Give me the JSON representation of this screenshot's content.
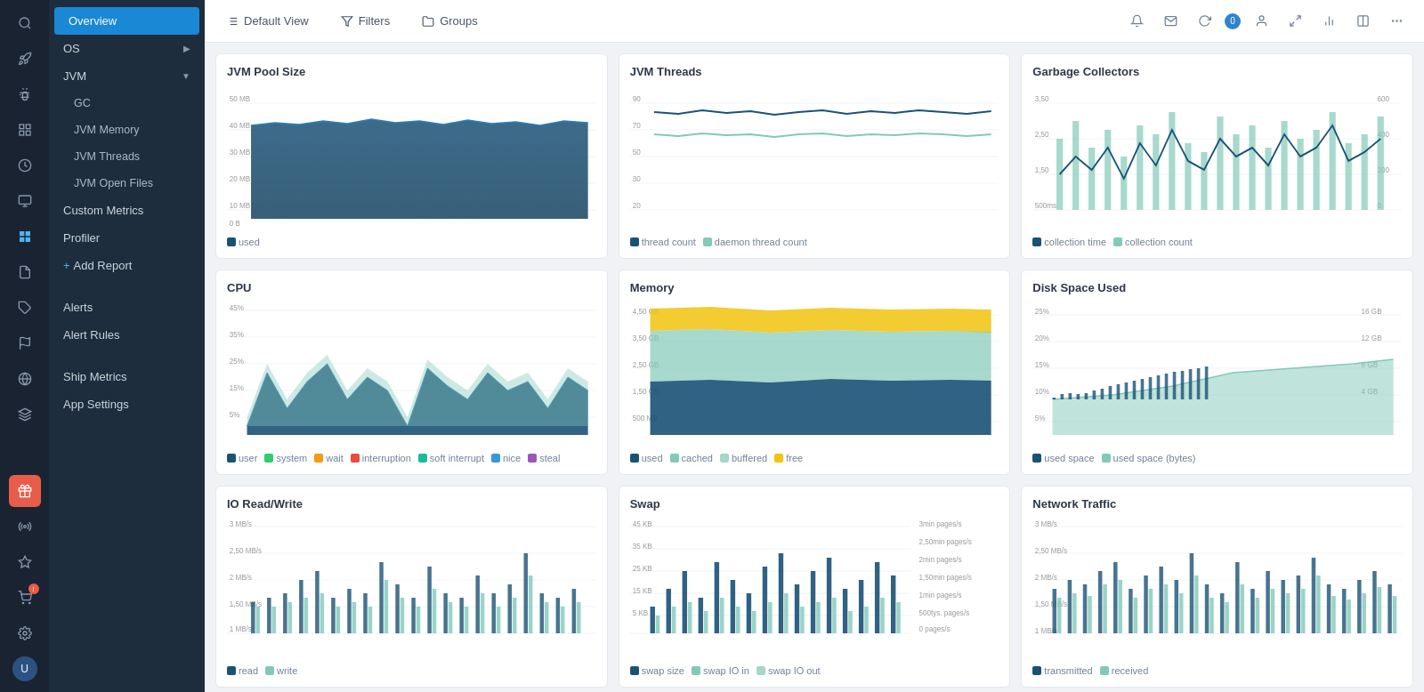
{
  "iconRail": {
    "icons": [
      {
        "name": "search-icon",
        "symbol": "🔍"
      },
      {
        "name": "rocket-icon",
        "symbol": "🚀"
      },
      {
        "name": "bug-icon",
        "symbol": "🐛"
      },
      {
        "name": "grid-icon",
        "symbol": "⊞"
      },
      {
        "name": "clock-icon",
        "symbol": "⏱"
      },
      {
        "name": "monitor-icon",
        "symbol": "🖥"
      },
      {
        "name": "dashboard-active-icon",
        "symbol": "▦"
      },
      {
        "name": "document-icon",
        "symbol": "📄"
      },
      {
        "name": "puzzle-icon",
        "symbol": "🧩"
      },
      {
        "name": "flag-icon",
        "symbol": "🚩"
      },
      {
        "name": "globe-icon",
        "symbol": "🌐"
      },
      {
        "name": "layers-icon",
        "symbol": "⚙"
      }
    ],
    "bottomIcons": [
      {
        "name": "gift-icon",
        "symbol": "🎁"
      },
      {
        "name": "broadcast-icon",
        "symbol": "📡"
      },
      {
        "name": "star-icon",
        "symbol": "⭐"
      },
      {
        "name": "cart-icon",
        "symbol": "🛒"
      },
      {
        "name": "settings-icon",
        "symbol": "⚙"
      },
      {
        "name": "user-icon",
        "symbol": "👤"
      }
    ]
  },
  "sidebar": {
    "items": [
      {
        "label": "Overview",
        "active": true,
        "type": "main"
      },
      {
        "label": "OS",
        "type": "main",
        "hasArrow": true
      },
      {
        "label": "JVM",
        "type": "main",
        "hasChevron": true,
        "expanded": true
      },
      {
        "label": "GC",
        "type": "sub"
      },
      {
        "label": "JVM Memory",
        "type": "sub"
      },
      {
        "label": "JVM Threads",
        "type": "sub"
      },
      {
        "label": "JVM Open Files",
        "type": "sub"
      },
      {
        "label": "Custom Metrics",
        "type": "main"
      },
      {
        "label": "Profiler",
        "type": "main"
      },
      {
        "label": "Add Report",
        "type": "action"
      },
      {
        "label": "Alerts",
        "type": "main"
      },
      {
        "label": "Alert Rules",
        "type": "main"
      },
      {
        "label": "Ship Metrics",
        "type": "main"
      },
      {
        "label": "App Settings",
        "type": "main"
      }
    ]
  },
  "topbar": {
    "defaultView": "Default View",
    "filters": "Filters",
    "groups": "Groups",
    "badgeCount": "0"
  },
  "charts": [
    {
      "id": "jvm-pool-size",
      "title": "JVM Pool Size",
      "type": "area",
      "legend": [
        {
          "label": "used",
          "color": "#1a5276"
        }
      ]
    },
    {
      "id": "jvm-threads",
      "title": "JVM Threads",
      "type": "line",
      "legend": [
        {
          "label": "thread count",
          "color": "#1a5276"
        },
        {
          "label": "daemon thread count",
          "color": "#82c9b8"
        }
      ]
    },
    {
      "id": "garbage-collectors",
      "title": "Garbage Collectors",
      "type": "bar-line",
      "legend": [
        {
          "label": "collection time",
          "color": "#1a5276"
        },
        {
          "label": "collection count",
          "color": "#82c9b8"
        }
      ]
    },
    {
      "id": "cpu",
      "title": "CPU",
      "type": "stacked-area",
      "legend": [
        {
          "label": "user",
          "color": "#1a5276"
        },
        {
          "label": "system",
          "color": "#2ecc71"
        },
        {
          "label": "wait",
          "color": "#f39c12"
        },
        {
          "label": "interruption",
          "color": "#e74c3c"
        },
        {
          "label": "soft interrupt",
          "color": "#1abc9c"
        },
        {
          "label": "nice",
          "color": "#3498db"
        },
        {
          "label": "steal",
          "color": "#9b59b6"
        }
      ]
    },
    {
      "id": "memory",
      "title": "Memory",
      "type": "stacked-area",
      "legend": [
        {
          "label": "used",
          "color": "#1a5276"
        },
        {
          "label": "cached",
          "color": "#82c9b8"
        },
        {
          "label": "buffered",
          "color": "#a8d5c8"
        },
        {
          "label": "free",
          "color": "#f1c40f"
        }
      ]
    },
    {
      "id": "disk-space",
      "title": "Disk Space Used",
      "type": "area-bar",
      "legend": [
        {
          "label": "used space",
          "color": "#1a5276"
        },
        {
          "label": "used space (bytes)",
          "color": "#82c9b8"
        }
      ]
    },
    {
      "id": "io-readwrite",
      "title": "IO Read/Write",
      "type": "bar",
      "legend": [
        {
          "label": "read",
          "color": "#1a5276"
        },
        {
          "label": "write",
          "color": "#82c9b8"
        }
      ]
    },
    {
      "id": "swap",
      "title": "Swap",
      "type": "bar",
      "legend": [
        {
          "label": "swap size",
          "color": "#1a5276"
        },
        {
          "label": "swap IO in",
          "color": "#82c9b8"
        },
        {
          "label": "swap IO out",
          "color": "#a8d5c8"
        }
      ]
    },
    {
      "id": "network-traffic",
      "title": "Network Traffic",
      "type": "bar",
      "legend": [
        {
          "label": "transmitted",
          "color": "#1a5276"
        },
        {
          "label": "received",
          "color": "#82c9b8"
        }
      ]
    }
  ]
}
